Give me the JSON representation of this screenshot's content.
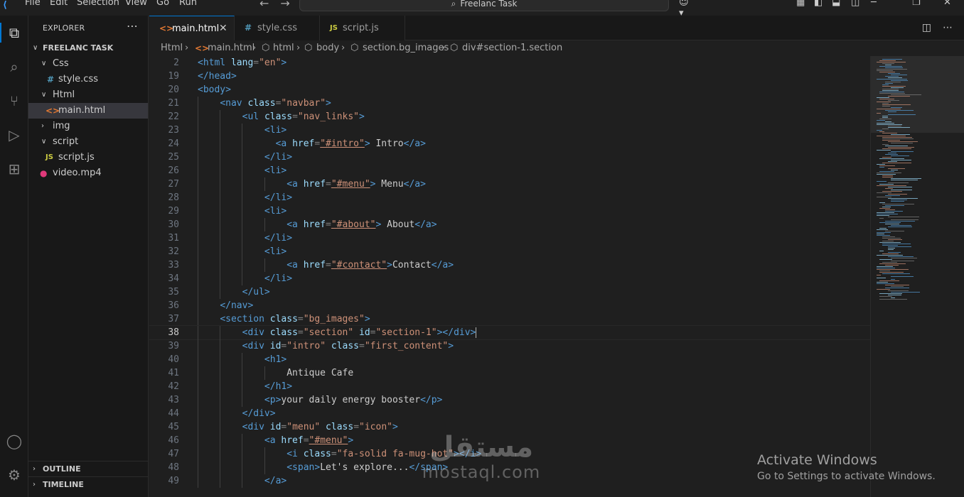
{
  "titlebar": {
    "menu": [
      "File",
      "Edit",
      "Selection",
      "View",
      "Go",
      "Run"
    ],
    "search_text": "Freelanc Task"
  },
  "activity_icons": [
    "explorer-icon",
    "search-icon",
    "source-control-icon",
    "run-debug-icon",
    "extensions-icon",
    "account-icon",
    "settings-icon"
  ],
  "explorer": {
    "header": "EXPLORER",
    "root": "FREELANC TASK",
    "items": [
      {
        "label": "Css",
        "type": "folder",
        "open": true
      },
      {
        "label": "style.css",
        "type": "css"
      },
      {
        "label": "Html",
        "type": "folder",
        "open": true
      },
      {
        "label": "main.html",
        "type": "html",
        "selected": true
      },
      {
        "label": "img",
        "type": "folder",
        "open": false
      },
      {
        "label": "script",
        "type": "folder",
        "open": true
      },
      {
        "label": "script.js",
        "type": "js"
      },
      {
        "label": "video.mp4",
        "type": "video"
      }
    ],
    "outline": "OUTLINE",
    "timeline": "TIMELINE"
  },
  "tabs": [
    {
      "label": "main.html",
      "icon": "<>",
      "active": true
    },
    {
      "label": "style.css",
      "icon": "#"
    },
    {
      "label": "script.js",
      "icon": "JS"
    }
  ],
  "breadcrumb": [
    "Html",
    "main.html",
    "html",
    "body",
    "section.bg_images",
    "div#section-1.section"
  ],
  "code": [
    {
      "n": "2",
      "s": [
        [
          "tag",
          "<html "
        ],
        [
          "attr",
          "lang"
        ],
        [
          "pun",
          "="
        ],
        [
          "str",
          "\"en\""
        ],
        [
          "tag",
          ">"
        ]
      ]
    },
    {
      "n": "19",
      "s": [
        [
          "tag",
          "</head>"
        ]
      ]
    },
    {
      "n": "20",
      "s": [
        [
          "tag",
          "<body>"
        ]
      ]
    },
    {
      "n": "21",
      "s": [
        [
          "txt",
          "    "
        ],
        [
          "tag",
          "<nav "
        ],
        [
          "attr",
          "class"
        ],
        [
          "pun",
          "="
        ],
        [
          "str",
          "\"navbar\""
        ],
        [
          "tag",
          ">"
        ]
      ]
    },
    {
      "n": "22",
      "s": [
        [
          "txt",
          "        "
        ],
        [
          "tag",
          "<ul "
        ],
        [
          "attr",
          "class"
        ],
        [
          "pun",
          "="
        ],
        [
          "str",
          "\"nav_links\""
        ],
        [
          "tag",
          ">"
        ]
      ]
    },
    {
      "n": "23",
      "s": [
        [
          "txt",
          "            "
        ],
        [
          "tag",
          "<li>"
        ]
      ]
    },
    {
      "n": "24",
      "s": [
        [
          "txt",
          "              "
        ],
        [
          "tag",
          "<a "
        ],
        [
          "attr",
          "href"
        ],
        [
          "pun",
          "="
        ],
        [
          "str",
          "\"#intro\""
        ],
        [
          "tag",
          ">"
        ],
        [
          "txt",
          " Intro"
        ],
        [
          "tag",
          "</a>"
        ]
      ]
    },
    {
      "n": "25",
      "s": [
        [
          "txt",
          "            "
        ],
        [
          "tag",
          "</li>"
        ]
      ]
    },
    {
      "n": "26",
      "s": [
        [
          "txt",
          "            "
        ],
        [
          "tag",
          "<li>"
        ]
      ]
    },
    {
      "n": "27",
      "s": [
        [
          "txt",
          "                "
        ],
        [
          "tag",
          "<a "
        ],
        [
          "attr",
          "href"
        ],
        [
          "pun",
          "="
        ],
        [
          "str",
          "\"#menu\""
        ],
        [
          "tag",
          ">"
        ],
        [
          "txt",
          " Menu"
        ],
        [
          "tag",
          "</a>"
        ]
      ]
    },
    {
      "n": "28",
      "s": [
        [
          "txt",
          "            "
        ],
        [
          "tag",
          "</li>"
        ]
      ]
    },
    {
      "n": "29",
      "s": [
        [
          "txt",
          "            "
        ],
        [
          "tag",
          "<li>"
        ]
      ]
    },
    {
      "n": "30",
      "s": [
        [
          "txt",
          "                "
        ],
        [
          "tag",
          "<a "
        ],
        [
          "attr",
          "href"
        ],
        [
          "pun",
          "="
        ],
        [
          "str",
          "\"#about\""
        ],
        [
          "tag",
          ">"
        ],
        [
          "txt",
          " About"
        ],
        [
          "tag",
          "</a>"
        ]
      ]
    },
    {
      "n": "31",
      "s": [
        [
          "txt",
          "            "
        ],
        [
          "tag",
          "</li>"
        ]
      ]
    },
    {
      "n": "32",
      "s": [
        [
          "txt",
          "            "
        ],
        [
          "tag",
          "<li>"
        ]
      ]
    },
    {
      "n": "33",
      "s": [
        [
          "txt",
          "                "
        ],
        [
          "tag",
          "<a "
        ],
        [
          "attr",
          "href"
        ],
        [
          "pun",
          "="
        ],
        [
          "str",
          "\"#contact\""
        ],
        [
          "tag",
          ">"
        ],
        [
          "txt",
          "Contact"
        ],
        [
          "tag",
          "</a>"
        ]
      ]
    },
    {
      "n": "34",
      "s": [
        [
          "txt",
          "            "
        ],
        [
          "tag",
          "</li>"
        ]
      ]
    },
    {
      "n": "35",
      "s": [
        [
          "txt",
          "        "
        ],
        [
          "tag",
          "</ul>"
        ]
      ]
    },
    {
      "n": "36",
      "s": [
        [
          "txt",
          "    "
        ],
        [
          "tag",
          "</nav>"
        ]
      ]
    },
    {
      "n": "37",
      "s": [
        [
          "txt",
          "    "
        ],
        [
          "tag",
          "<section "
        ],
        [
          "attr",
          "class"
        ],
        [
          "pun",
          "="
        ],
        [
          "str",
          "\"bg_images\""
        ],
        [
          "tag",
          ">"
        ]
      ]
    },
    {
      "n": "38",
      "current": true,
      "s": [
        [
          "txt",
          "        "
        ],
        [
          "tag",
          "<div "
        ],
        [
          "attr",
          "class"
        ],
        [
          "pun",
          "="
        ],
        [
          "str",
          "\"section\""
        ],
        [
          "txt",
          " "
        ],
        [
          "attr",
          "id"
        ],
        [
          "pun",
          "="
        ],
        [
          "str",
          "\"section-1\""
        ],
        [
          "tag",
          "></div>"
        ]
      ]
    },
    {
      "n": "39",
      "s": [
        [
          "txt",
          "        "
        ],
        [
          "tag",
          "<div "
        ],
        [
          "attr",
          "id"
        ],
        [
          "pun",
          "="
        ],
        [
          "str",
          "\"intro\""
        ],
        [
          "txt",
          " "
        ],
        [
          "attr",
          "class"
        ],
        [
          "pun",
          "="
        ],
        [
          "str",
          "\"first_content\""
        ],
        [
          "tag",
          ">"
        ]
      ]
    },
    {
      "n": "40",
      "s": [
        [
          "txt",
          "            "
        ],
        [
          "tag",
          "<h1>"
        ]
      ]
    },
    {
      "n": "41",
      "s": [
        [
          "txt",
          "                Antique Cafe"
        ]
      ]
    },
    {
      "n": "42",
      "s": [
        [
          "txt",
          "            "
        ],
        [
          "tag",
          "</h1>"
        ]
      ]
    },
    {
      "n": "43",
      "s": [
        [
          "txt",
          "            "
        ],
        [
          "tag",
          "<p>"
        ],
        [
          "txt",
          "your daily energy booster"
        ],
        [
          "tag",
          "</p>"
        ]
      ]
    },
    {
      "n": "44",
      "s": [
        [
          "txt",
          "        "
        ],
        [
          "tag",
          "</div>"
        ]
      ]
    },
    {
      "n": "45",
      "s": [
        [
          "txt",
          "        "
        ],
        [
          "tag",
          "<div "
        ],
        [
          "attr",
          "id"
        ],
        [
          "pun",
          "="
        ],
        [
          "str",
          "\"menu\""
        ],
        [
          "txt",
          " "
        ],
        [
          "attr",
          "class"
        ],
        [
          "pun",
          "="
        ],
        [
          "str",
          "\"icon\""
        ],
        [
          "tag",
          ">"
        ]
      ]
    },
    {
      "n": "46",
      "s": [
        [
          "txt",
          "            "
        ],
        [
          "tag",
          "<a "
        ],
        [
          "attr",
          "href"
        ],
        [
          "pun",
          "="
        ],
        [
          "str",
          "\"#menu\""
        ],
        [
          "tag",
          ">"
        ]
      ]
    },
    {
      "n": "47",
      "s": [
        [
          "txt",
          "                "
        ],
        [
          "tag",
          "<i "
        ],
        [
          "attr",
          "class"
        ],
        [
          "pun",
          "="
        ],
        [
          "str",
          "\"fa-solid fa-mug-hot\""
        ],
        [
          "tag",
          "></i>"
        ]
      ]
    },
    {
      "n": "48",
      "s": [
        [
          "txt",
          "                "
        ],
        [
          "tag",
          "<span>"
        ],
        [
          "txt",
          "Let's explore..."
        ],
        [
          "tag",
          "</span>"
        ]
      ]
    },
    {
      "n": "49",
      "s": [
        [
          "txt",
          "            "
        ],
        [
          "tag",
          "</a>"
        ]
      ]
    }
  ],
  "watermark": {
    "title": "Activate Windows",
    "subtitle": "Go to Settings to activate Windows.",
    "logo_ar": "مستقل",
    "logo_en": "mostaql.com"
  },
  "colors": {
    "accent": "#0078d4",
    "tag": "#569cd6",
    "attr": "#9cdcfe",
    "str": "#ce9178"
  }
}
